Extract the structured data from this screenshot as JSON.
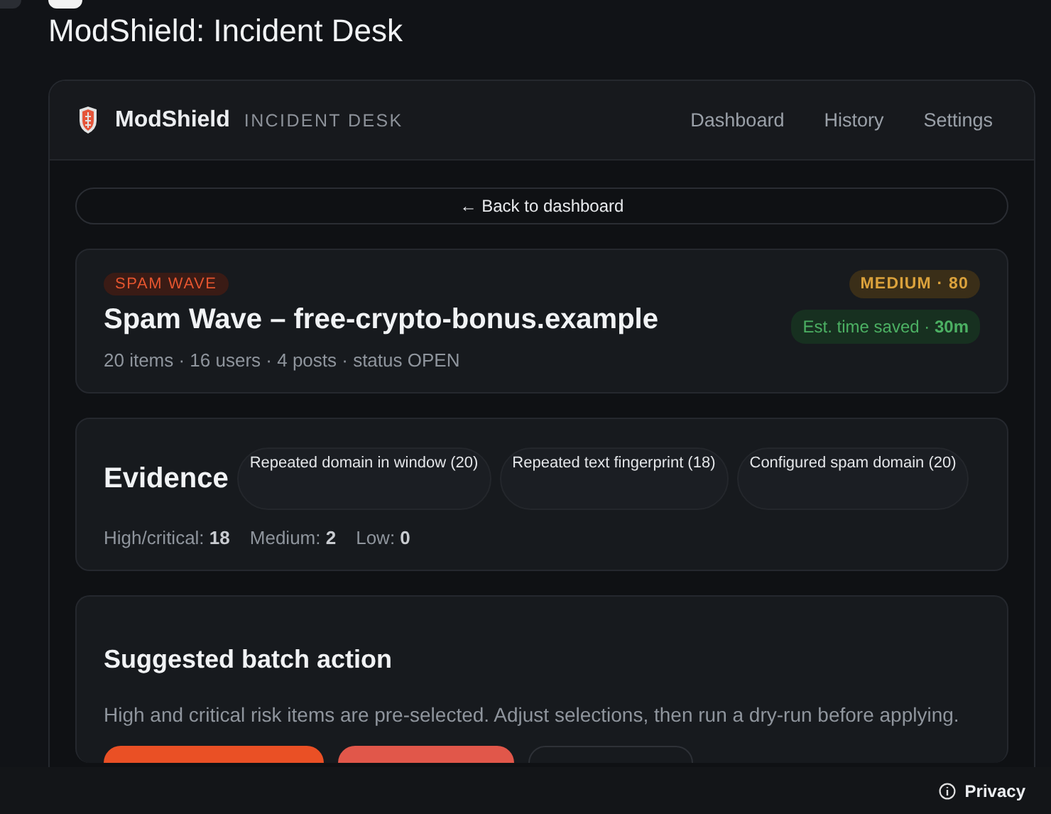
{
  "page": {
    "title": "ModShield: Incident Desk"
  },
  "app": {
    "brand": "ModShield",
    "subtitle": "INCIDENT DESK",
    "nav": [
      {
        "label": "Dashboard"
      },
      {
        "label": "History"
      },
      {
        "label": "Settings"
      }
    ]
  },
  "back_button": "← Back to dashboard",
  "incident": {
    "tag": "SPAM WAVE",
    "title": "Spam Wave – free-crypto-bonus.example",
    "meta": "20 items · 16 users · 4 posts · status OPEN",
    "severity": "MEDIUM · 80",
    "time_saved": "Est. time saved · **30m**"
  },
  "evidence": {
    "heading": "Evidence",
    "signals": [
      "Repeated domain in window (20)",
      "Repeated text fingerprint (18)",
      "Configured spam domain (20)"
    ],
    "counts": [
      "High/critical: **18**",
      "Medium: **2**",
      "Low: **0**"
    ]
  },
  "batch": {
    "heading": "Suggested batch action",
    "description": "High and critical risk items are pre-selected. Adjust selections, then run a dry-run before applying.",
    "buttons": [
      {
        "kind": "primary"
      },
      {
        "kind": "danger"
      },
      {
        "kind": "outline"
      }
    ]
  },
  "footer": {
    "privacy": "Privacy"
  }
}
